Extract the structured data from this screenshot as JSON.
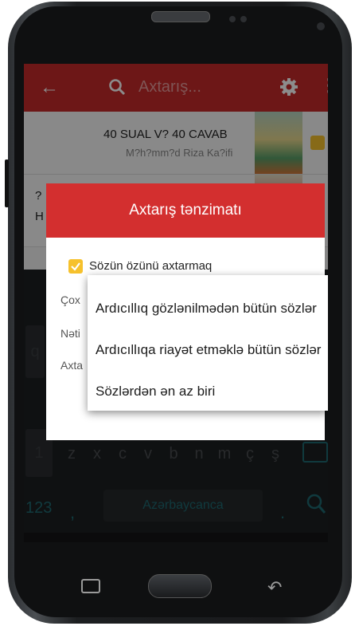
{
  "search": {
    "placeholder": "Axtarış..."
  },
  "list": {
    "items": [
      {
        "title": "40 SUAL V? 40 CAVAB",
        "author": "M?h?mm?d Riza Ka?ifi"
      },
      {
        "title": "?",
        "author": "H"
      }
    ]
  },
  "dialog": {
    "title": "Axtarış tənzimatı",
    "checkbox_label": "Sözün özünü axtarmaq",
    "row1_label": "Çox",
    "row2_label": "Nəti",
    "row3_label": "Axta"
  },
  "dropdown": {
    "options": [
      "Ardıcıllıq gözlənilmədən bütün sözlər",
      "Ardıcıllıqa riayət etməklə bütün sözlər",
      "Sözlərdən ən az biri"
    ]
  },
  "keyboard": {
    "row_letters": [
      "z",
      "x",
      "c",
      "v",
      "b",
      "n",
      "m",
      "ç",
      "ş"
    ],
    "left_key": "q",
    "num_key": "123",
    "comma": ",",
    "space_label": "Azərbaycanca",
    "period": ".",
    "extra_left_digit": "1"
  },
  "colors": {
    "accent": "#c62a2a",
    "checkbox": "#f6c12c"
  }
}
